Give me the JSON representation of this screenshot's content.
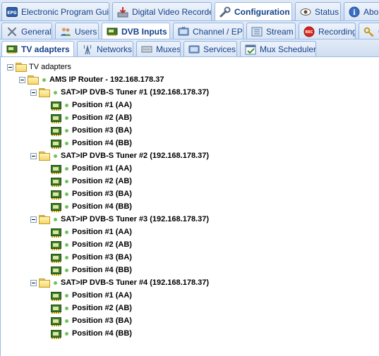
{
  "main_tabs": [
    {
      "label": "Electronic Program Guide",
      "icon": "epg-icon",
      "active": false
    },
    {
      "label": "Digital Video Recorder",
      "icon": "dvr-download-icon",
      "active": false
    },
    {
      "label": "Configuration",
      "icon": "wrench-icon",
      "active": true
    },
    {
      "label": "Status",
      "icon": "eye-icon",
      "active": false
    },
    {
      "label": "About",
      "icon": "info-icon",
      "active": false
    }
  ],
  "config_tabs": [
    {
      "label": "General",
      "icon": "tools-icon",
      "active": false
    },
    {
      "label": "Users",
      "icon": "users-icon",
      "active": false
    },
    {
      "label": "DVB Inputs",
      "icon": "dvb-card-icon",
      "active": true
    },
    {
      "label": "Channel / EPG",
      "icon": "tv-icon",
      "active": false
    },
    {
      "label": "Stream",
      "icon": "stream-icon",
      "active": false
    },
    {
      "label": "Recording",
      "icon": "rec-icon",
      "active": false
    },
    {
      "label": "C",
      "icon": "key-icon",
      "active": false
    }
  ],
  "dvb_tabs": [
    {
      "label": "TV adapters",
      "icon": "tv-adapter-icon",
      "active": true
    },
    {
      "label": "Networks",
      "icon": "antenna-icon",
      "active": false
    },
    {
      "label": "Muxes",
      "icon": "mux-icon",
      "active": false
    },
    {
      "label": "Services",
      "icon": "services-icon",
      "active": false
    },
    {
      "label": "Mux Schedulers",
      "icon": "scheduler-icon",
      "active": false
    }
  ],
  "tree": {
    "root": "TV adapters",
    "router": "AMS IP Router - 192.168.178.37",
    "tuners": [
      {
        "label": "SAT>IP DVB-S Tuner #1 (192.168.178.37)",
        "positions": [
          "Position #1 (AA)",
          "Position #2 (AB)",
          "Position #3 (BA)",
          "Position #4 (BB)"
        ]
      },
      {
        "label": "SAT>IP DVB-S Tuner #2 (192.168.178.37)",
        "positions": [
          "Position #1 (AA)",
          "Position #2 (AB)",
          "Position #3 (BA)",
          "Position #4 (BB)"
        ]
      },
      {
        "label": "SAT>IP DVB-S Tuner #3 (192.168.178.37)",
        "positions": [
          "Position #1 (AA)",
          "Position #2 (AB)",
          "Position #3 (BA)",
          "Position #4 (BB)"
        ]
      },
      {
        "label": "SAT>IP DVB-S Tuner #4 (192.168.178.37)",
        "positions": [
          "Position #1 (AA)",
          "Position #2 (AB)",
          "Position #3 (BA)",
          "Position #4 (BB)"
        ]
      }
    ]
  },
  "colors": {
    "tab_text": "#15428b",
    "tab_border": "#99bbe8",
    "status_dot": "#6fc25a"
  }
}
